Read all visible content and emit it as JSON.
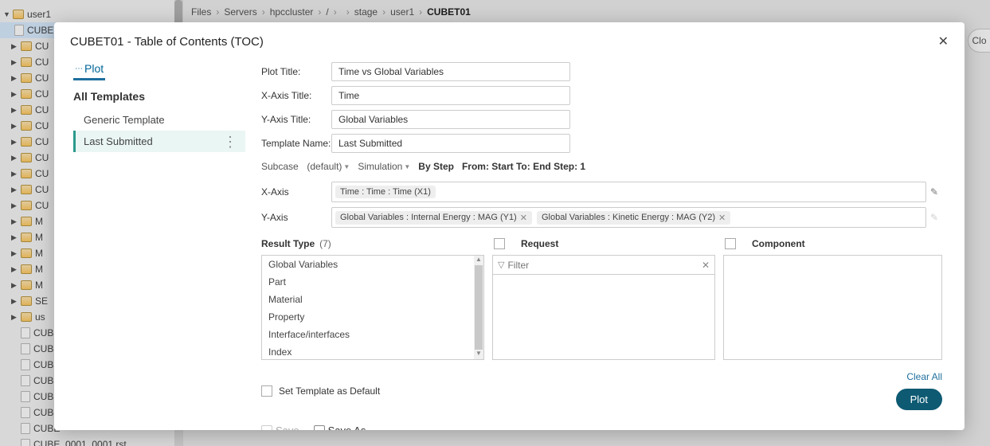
{
  "breadcrumb": {
    "root": "Files",
    "parts": [
      "Servers",
      "hpccluster",
      "/",
      "",
      "stage",
      "user1"
    ],
    "current": "CUBET01"
  },
  "close_outer": "Clo",
  "tree": {
    "root": "user1",
    "selected": "CUBE",
    "folders": [
      "CU",
      "CU",
      "CU",
      "CU",
      "CU",
      "CU",
      "CU",
      "CU",
      "CU",
      "CU",
      "CU",
      "M",
      "M",
      "M",
      "M",
      "M",
      "SE",
      "us"
    ],
    "files": [
      "CUBE",
      "CUBE",
      "CUBE",
      "CUBE",
      "CUBE",
      "CUBE",
      "CUBE",
      "CUBE_0001_0001.rst"
    ]
  },
  "modal": {
    "title": "CUBET01 - Table of Contents (TOC)",
    "tab": "Plot",
    "templates_head": "All Templates",
    "templates": [
      {
        "label": "Generic Template",
        "active": false
      },
      {
        "label": "Last Submitted",
        "active": true
      }
    ],
    "form": {
      "plot_title_label": "Plot Title:",
      "plot_title": "Time vs Global Variables",
      "x_title_label": "X-Axis Title:",
      "x_title": "Time",
      "y_title_label": "Y-Axis Title:",
      "y_title": "Global Variables",
      "tmpl_name_label": "Template Name:",
      "tmpl_name": "Last Submitted"
    },
    "params": {
      "subcase_label": "Subcase",
      "subcase_value": "(default)",
      "sim_label": "Simulation",
      "by_step": "By Step",
      "range": "From: Start To: End Step: 1"
    },
    "axes": {
      "x_label": "X-Axis",
      "x_chips": [
        "Time : Time : Time (X1)"
      ],
      "y_label": "Y-Axis",
      "y_chips": [
        "Global Variables : Internal Energy : MAG (Y1)",
        "Global Variables : Kinetic Energy : MAG (Y2)"
      ]
    },
    "columns": {
      "result_label": "Result Type",
      "result_count": "(7)",
      "result_items": [
        "Global Variables",
        "Part",
        "Material",
        "Property",
        "Interface/interfaces",
        "Index"
      ],
      "request_label": "Request",
      "filter_placeholder": "Filter",
      "component_label": "Component"
    },
    "bottom": {
      "default_label": "Set Template as Default",
      "save": "Save",
      "save_as": "Save As",
      "clear": "Clear All",
      "plot": "Plot"
    }
  }
}
